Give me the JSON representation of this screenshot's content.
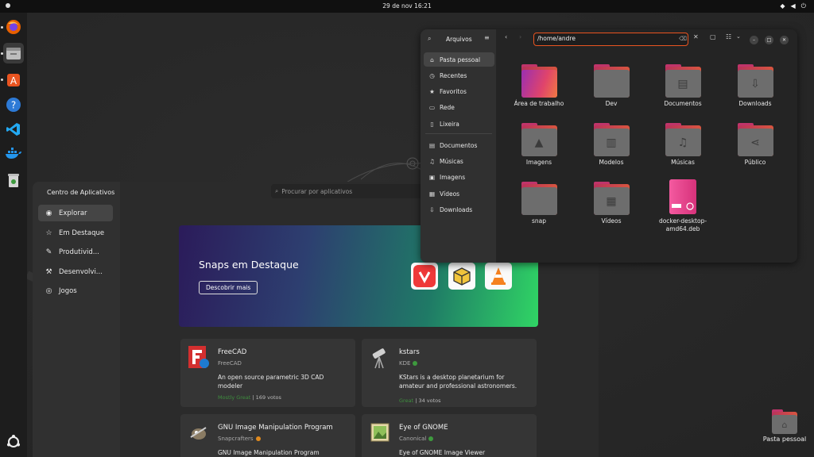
{
  "topbar": {
    "clock": "29 de nov  16:21"
  },
  "desktop": {
    "icon_label": "Pasta pessoal"
  },
  "app_center": {
    "title": "Centro de Aplicativos",
    "search_placeholder": "Procurar por aplicativos",
    "nav": [
      "Explorar",
      "Em Destaque",
      "Produtivid...",
      "Desenvolvi...",
      "Jogos"
    ],
    "banner": {
      "title": "Snaps em Destaque",
      "button": "Descobrir mais"
    },
    "cards": [
      {
        "name": "FreeCAD",
        "publisher": "FreeCAD",
        "description": "An open source parametric 3D CAD modeler",
        "rating": "Mostly Great",
        "votes": "| 169 votos"
      },
      {
        "name": "kstars",
        "publisher": "KDE",
        "description": "KStars is a desktop planetarium for amateur and professional astronomers.",
        "rating": "Great",
        "votes": "| 34 votos"
      },
      {
        "name": "GNU Image Manipulation Program",
        "publisher": "Snapcrafters",
        "description": "GNU Image Manipulation Program"
      },
      {
        "name": "Eye of GNOME",
        "publisher": "Canonical",
        "description": "Eye of GNOME Image Viewer"
      }
    ]
  },
  "files": {
    "title": "Arquivos",
    "path": "/home/andre",
    "sidebar": [
      "Pasta pessoal",
      "Recentes",
      "Favoritos",
      "Rede",
      "Lixeira",
      "Documentos",
      "Músicas",
      "Imagens",
      "Vídeos",
      "Downloads"
    ],
    "folders": [
      "Área de trabalho",
      "Dev",
      "Documentos",
      "Downloads",
      "Imagens",
      "Modelos",
      "Músicas",
      "Público",
      "snap",
      "Vídeos",
      "docker-desktop-amd64.deb"
    ]
  }
}
